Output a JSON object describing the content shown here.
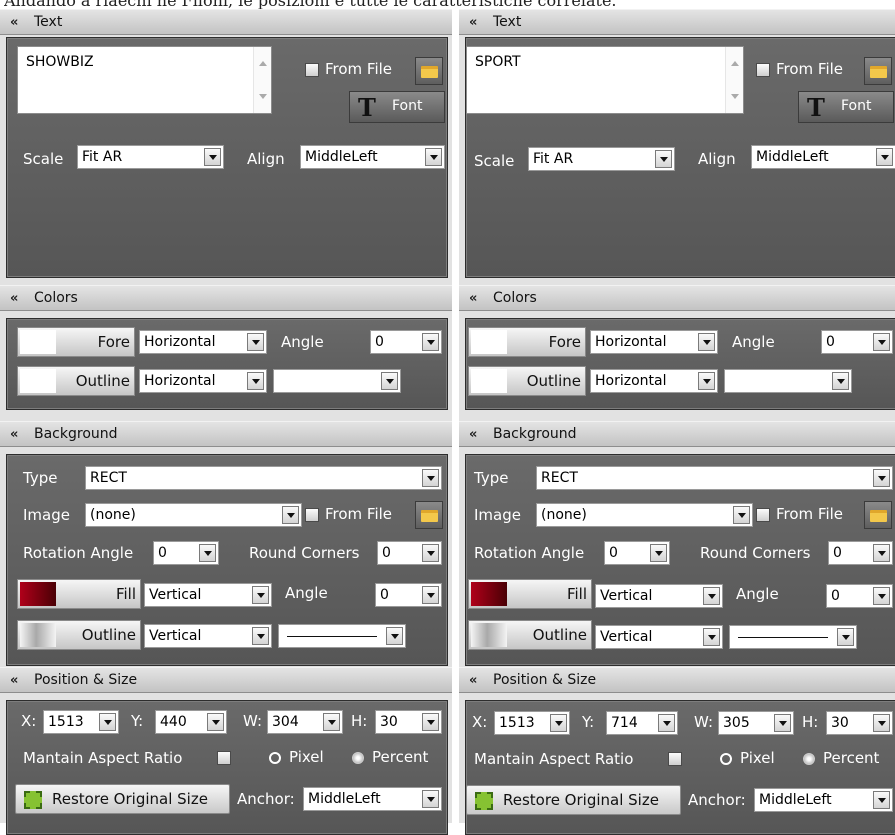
{
  "caption": "Andando a riaechi ne Filoni, le posizioni e tutte le caratteristiche correlate.",
  "colors": {
    "panel_bg": "#606060",
    "header_bg": "#d0d0d0",
    "fill_swatch": "#7a0010",
    "label": "#ffffff"
  },
  "panels": [
    {
      "text": {
        "header": "Text",
        "content": "SHOWBIZ",
        "from_file": "From File",
        "font": "Font",
        "scale_label": "Scale",
        "scale_value": "Fit AR",
        "align_label": "Align",
        "align_value": "MiddleLeft"
      },
      "colors": {
        "header": "Colors",
        "fore": "Fore",
        "fore_mode": "Horizontal",
        "angle_label": "Angle",
        "angle_value": "0",
        "outline": "Outline",
        "outline_mode": "Horizontal",
        "outline_extra": ""
      },
      "background": {
        "header": "Background",
        "type_label": "Type",
        "type_value": "RECT",
        "image_label": "Image",
        "image_value": "(none)",
        "from_file": "From File",
        "rotation_label": "Rotation Angle",
        "rotation_value": "0",
        "round_label": "Round Corners",
        "round_value": "0",
        "fill": "Fill",
        "fill_mode": "Vertical",
        "angle_label": "Angle",
        "angle_value": "0",
        "outline": "Outline",
        "outline_mode": "Vertical"
      },
      "position": {
        "header": "Position & Size",
        "x_label": "X:",
        "x_value": "1513",
        "y_label": "Y:",
        "y_value": "440",
        "w_label": "W:",
        "w_value": "304",
        "h_label": "H:",
        "h_value": "30",
        "aspect_label": "Mantain Aspect Ratio",
        "pixel_label": "Pixel",
        "percent_label": "Percent",
        "restore_label": "Restore Original Size",
        "anchor_label": "Anchor:",
        "anchor_value": "MiddleLeft"
      }
    },
    {
      "text": {
        "header": "Text",
        "content": "SPORT",
        "from_file": "From File",
        "font": "Font",
        "scale_label": "Scale",
        "scale_value": "Fit AR",
        "align_label": "Align",
        "align_value": "MiddleLeft"
      },
      "colors": {
        "header": "Colors",
        "fore": "Fore",
        "fore_mode": "Horizontal",
        "angle_label": "Angle",
        "angle_value": "0",
        "outline": "Outline",
        "outline_mode": "Horizontal",
        "outline_extra": ""
      },
      "background": {
        "header": "Background",
        "type_label": "Type",
        "type_value": "RECT",
        "image_label": "Image",
        "image_value": "(none)",
        "from_file": "From File",
        "rotation_label": "Rotation Angle",
        "rotation_value": "0",
        "round_label": "Round Corners",
        "round_value": "0",
        "fill": "Fill",
        "fill_mode": "Vertical",
        "angle_label": "Angle",
        "angle_value": "0",
        "outline": "Outline",
        "outline_mode": "Vertical"
      },
      "position": {
        "header": "Position & Size",
        "x_label": "X:",
        "x_value": "1513",
        "y_label": "Y:",
        "y_value": "714",
        "w_label": "W:",
        "w_value": "305",
        "h_label": "H:",
        "h_value": "30",
        "aspect_label": "Mantain Aspect Ratio",
        "pixel_label": "Pixel",
        "percent_label": "Percent",
        "restore_label": "Restore Original Size",
        "anchor_label": "Anchor:",
        "anchor_value": "MiddleLeft"
      }
    }
  ]
}
